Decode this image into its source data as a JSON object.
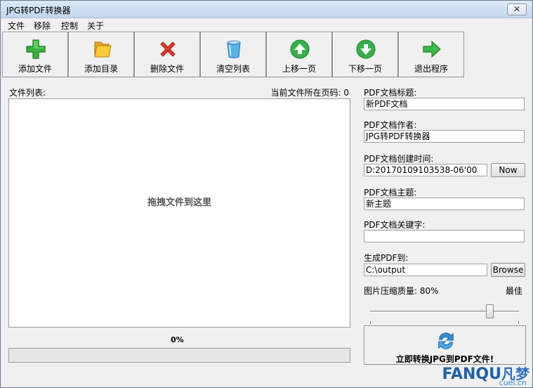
{
  "window": {
    "title": "JPG转PDF转换器",
    "close_glyph": "✕"
  },
  "menu": {
    "items": [
      "文件",
      "移除",
      "控制",
      "关于"
    ]
  },
  "toolbar": {
    "buttons": [
      {
        "label": "添加文件",
        "icon": "plus-icon"
      },
      {
        "label": "添加目录",
        "icon": "folder-icon"
      },
      {
        "label": "删除文件",
        "icon": "delete-x-icon"
      },
      {
        "label": "清空列表",
        "icon": "trash-can-icon"
      },
      {
        "label": "上移一页",
        "icon": "arrow-up-icon"
      },
      {
        "label": "下移一页",
        "icon": "arrow-down-icon"
      },
      {
        "label": "退出程序",
        "icon": "arrow-right-icon"
      }
    ]
  },
  "filelist": {
    "label": "文件列表:",
    "current_page_label": "当前文件所在页码: 0",
    "drop_hint": "拖拽文件到这里"
  },
  "progress": {
    "text": "0%",
    "value": 0
  },
  "pdf": {
    "title_label": "PDF文档标题:",
    "title_value": "新PDF文档",
    "author_label": "PDF文档作者:",
    "author_value": "JPG转PDF转换器",
    "created_label": "PDF文档创建时间:",
    "created_value": "D:20170109103538-06'00",
    "now_button": "Now",
    "subject_label": "PDF文档主题:",
    "subject_value": "新主题",
    "keywords_label": "PDF文档关键字:",
    "keywords_value": "",
    "output_label": "生成PDF到:",
    "output_value": "C:\\output",
    "browse_button": "Browse",
    "quality_label": "图片压缩质量: 80%",
    "quality_best": "最佳",
    "quality_value": 80
  },
  "convert": {
    "label": "立即转换JPG到PDF文件!",
    "icon": "convert-cycle-icon"
  },
  "watermark": {
    "brand": "FANQU",
    "cn": "凡梦",
    "sub": "cuel.cn"
  },
  "colors": {
    "accent_green": "#3fb84a",
    "titlebar": "#c4d7ee"
  }
}
